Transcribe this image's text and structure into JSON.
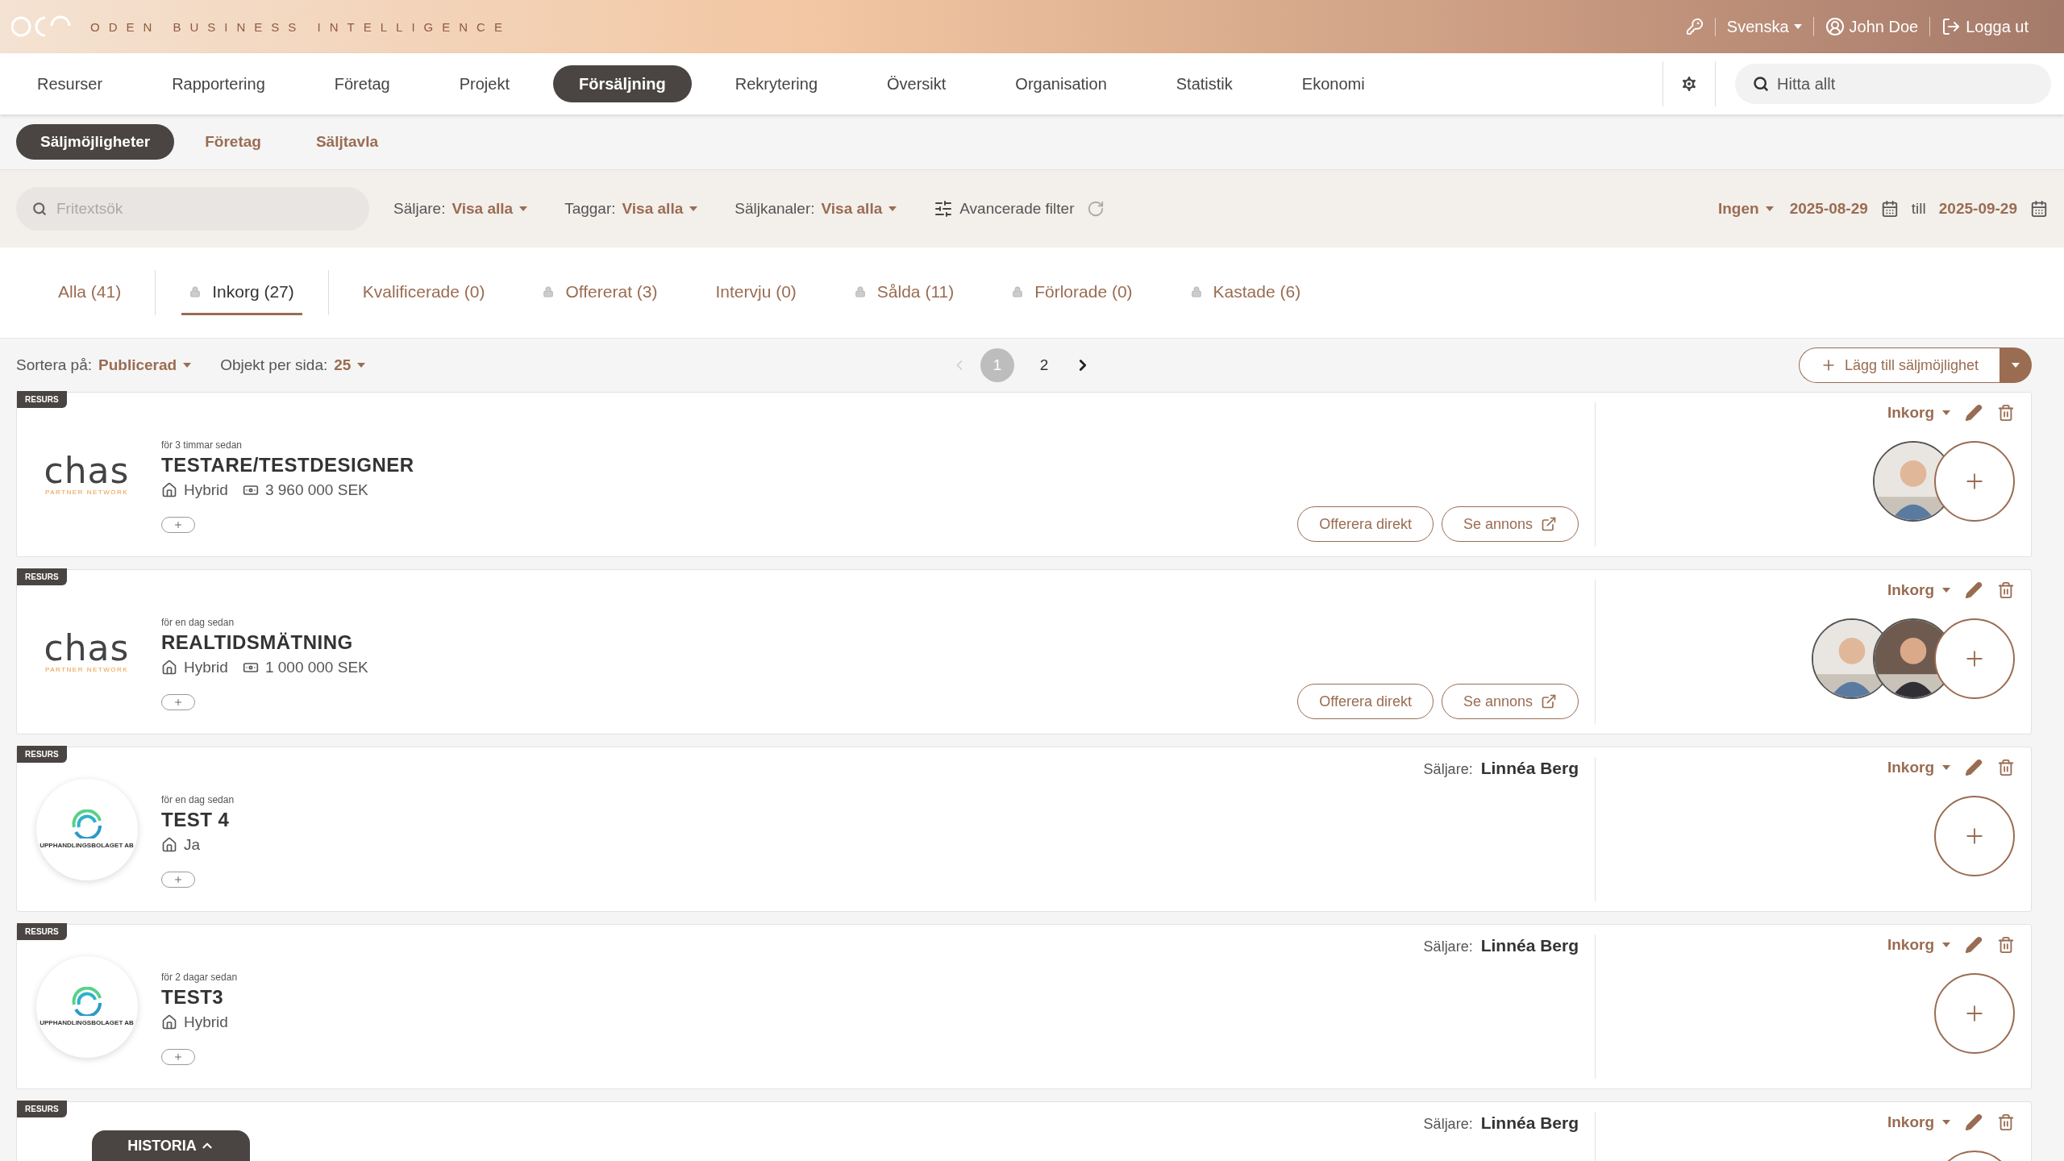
{
  "header": {
    "brand": "ODEN BUSINESS INTELLIGENCE",
    "language": "Svenska",
    "user": "John Doe",
    "logout": "Logga ut"
  },
  "nav": {
    "items": [
      {
        "label": "Resurser",
        "selected": false
      },
      {
        "label": "Rapportering",
        "selected": false
      },
      {
        "label": "Företag",
        "selected": false
      },
      {
        "label": "Projekt",
        "selected": false
      },
      {
        "label": "Försäljning",
        "selected": true
      },
      {
        "label": "Rekrytering",
        "selected": false
      },
      {
        "label": "Översikt",
        "selected": false
      },
      {
        "label": "Organisation",
        "selected": false
      },
      {
        "label": "Statistik",
        "selected": false
      },
      {
        "label": "Ekonomi",
        "selected": false
      }
    ],
    "search_placeholder": "Hitta allt"
  },
  "subnav": [
    {
      "label": "Säljmöjligheter",
      "selected": true
    },
    {
      "label": "Företag",
      "selected": false
    },
    {
      "label": "Säljtavla",
      "selected": false
    }
  ],
  "filters": {
    "search_placeholder": "Fritextsök",
    "dropdowns": [
      {
        "label": "Säljare:",
        "value": "Visa alla"
      },
      {
        "label": "Taggar:",
        "value": "Visa alla"
      },
      {
        "label": "Säljkanaler:",
        "value": "Visa alla"
      }
    ],
    "advanced": "Avancerade filter",
    "period": "Ingen",
    "from": "2025-08-29",
    "to_label": "till",
    "to": "2025-09-29"
  },
  "status_tabs": [
    {
      "label": "Alla (41)",
      "selected": false,
      "locked": false,
      "group_end": true
    },
    {
      "label": "Inkorg (27)",
      "selected": true,
      "locked": true,
      "group_end": true
    },
    {
      "label": "Kvalificerade (0)",
      "selected": false,
      "locked": false,
      "group_end": false
    },
    {
      "label": "Offererat (3)",
      "selected": false,
      "locked": true,
      "group_end": false
    },
    {
      "label": "Intervju (0)",
      "selected": false,
      "locked": false,
      "group_end": false
    },
    {
      "label": "Sålda (11)",
      "selected": false,
      "locked": true,
      "group_end": false
    },
    {
      "label": "Förlorade (0)",
      "selected": false,
      "locked": true,
      "group_end": false
    },
    {
      "label": "Kastade (6)",
      "selected": false,
      "locked": true,
      "group_end": false
    }
  ],
  "sort": {
    "label": "Sortera på:",
    "value": "Publicerad",
    "per_page_label": "Objekt per sida:",
    "per_page": "25"
  },
  "pagination": [
    {
      "label": "1",
      "selected": true
    },
    {
      "label": "2",
      "selected": false
    }
  ],
  "add_button": "Lägg till säljmöjlighet",
  "cards": [
    {
      "badge": "RESURS",
      "logo": {
        "kind": "chas",
        "name": "chas",
        "tagline": "PARTNER NETWORK"
      },
      "time": "för 3 timmar sedan",
      "title": "TESTARE/TESTDESIGNER",
      "location": "Hybrid",
      "amount": "3 960 000 SEK",
      "actions": [
        "Offerera direkt",
        "Se annons"
      ],
      "status": "Inkorg",
      "avatars": [
        {
          "kind": "picture"
        }
      ]
    },
    {
      "badge": "RESURS",
      "logo": {
        "kind": "chas",
        "name": "chas",
        "tagline": "PARTNER NETWORK"
      },
      "time": "för en dag sedan",
      "title": "REALTIDSMÄTNING",
      "location": "Hybrid",
      "amount": "1 000 000 SEK",
      "actions": [
        "Offerera direkt",
        "Se annons"
      ],
      "status": "Inkorg",
      "avatars": [
        {
          "kind": "picture"
        },
        {
          "kind": "picture"
        }
      ]
    },
    {
      "badge": "RESURS",
      "logo": {
        "kind": "swirl",
        "name": "UPPHANDLINGSBOLAGET AB"
      },
      "time": "för en dag sedan",
      "title": "TEST 4",
      "location": "Ja",
      "seller_label": "Säljare:",
      "seller": "Linnéa Berg",
      "status": "Inkorg"
    },
    {
      "badge": "RESURS",
      "logo": {
        "kind": "swirl",
        "name": "UPPHANDLINGSBOLAGET AB"
      },
      "time": "för 2 dagar sedan",
      "title": "TEST3",
      "location": "Hybrid",
      "seller_label": "Säljare:",
      "seller": "Linnéa Berg",
      "status": "Inkorg"
    },
    {
      "badge": "RESURS",
      "seller_label": "Säljare:",
      "seller": "Linnéa Berg",
      "status": "Inkorg"
    }
  ],
  "history_button": "HISTORIA"
}
